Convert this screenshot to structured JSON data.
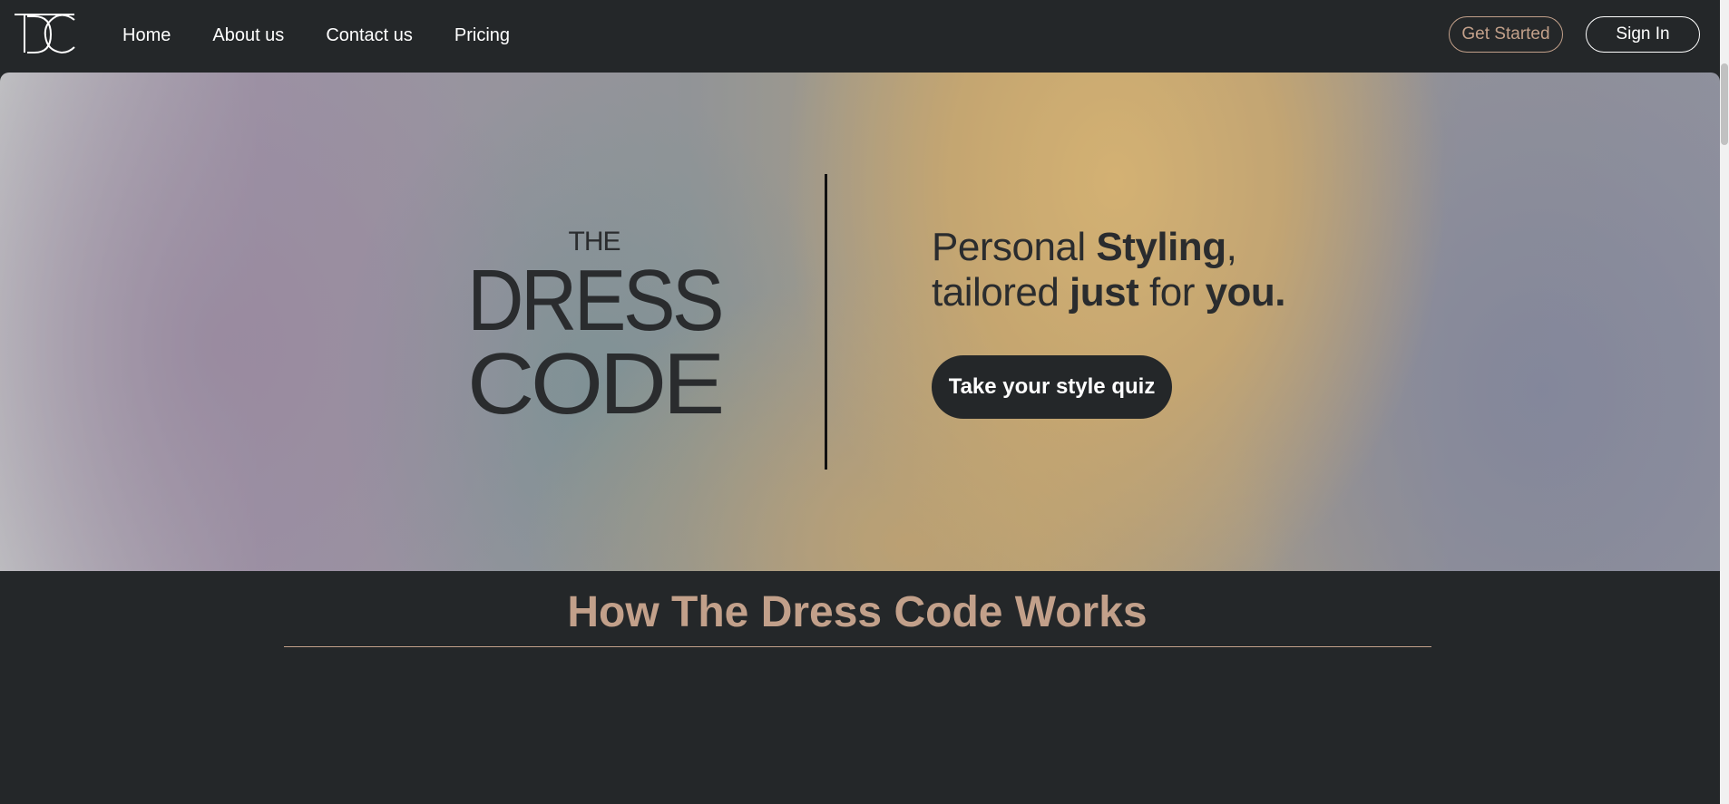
{
  "nav": {
    "logo_text": "TDC",
    "links": [
      {
        "label": "Home"
      },
      {
        "label": "About us"
      },
      {
        "label": "Contact us"
      },
      {
        "label": "Pricing"
      }
    ],
    "get_started_label": "Get Started",
    "sign_in_label": "Sign In"
  },
  "hero": {
    "brand_line1": "THE",
    "brand_line2": "DRESS",
    "brand_line3": "CODE",
    "tagline": {
      "p1": "Personal ",
      "p2": "Styling",
      "p3": ",",
      "p4": "tailored ",
      "p5": "just",
      "p6": " for ",
      "p7": "you."
    },
    "quiz_button_label": "Take your style quiz"
  },
  "how": {
    "title": "How The Dress Code Works"
  },
  "colors": {
    "background": "#242729",
    "accent": "#c2a08a",
    "text_light": "#ffffff",
    "text_dark": "#2a2c2e"
  }
}
